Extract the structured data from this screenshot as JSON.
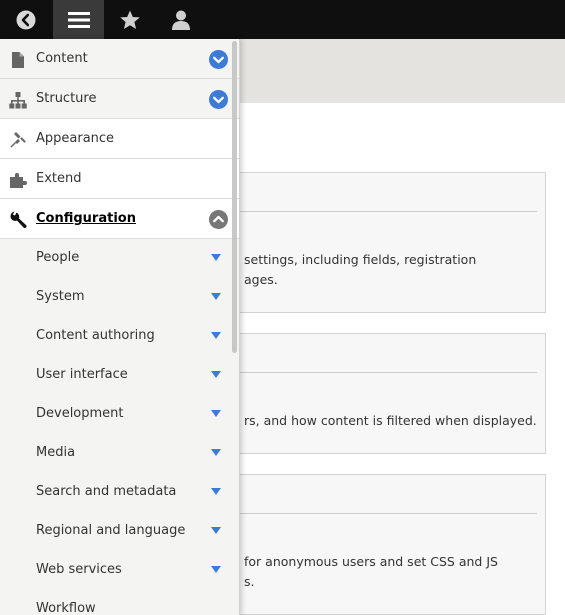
{
  "toolbar": {
    "buttons": [
      {
        "name": "back",
        "icon": "back-circle-icon"
      },
      {
        "name": "manage",
        "icon": "hamburger-menu-icon",
        "active": true
      },
      {
        "name": "shortcuts",
        "icon": "star-icon"
      },
      {
        "name": "user",
        "icon": "person-icon"
      }
    ]
  },
  "menu": {
    "items": [
      {
        "label": "Content",
        "icon": "document-icon",
        "toggle": "expand"
      },
      {
        "label": "Structure",
        "icon": "sitemap-icon",
        "toggle": "expand"
      },
      {
        "label": "Appearance",
        "icon": "paintbrush-icon"
      },
      {
        "label": "Extend",
        "icon": "puzzle-icon"
      },
      {
        "label": "Configuration",
        "icon": "wrench-icon",
        "toggle": "collapse",
        "active": true
      }
    ],
    "subitems": [
      "People",
      "System",
      "Content authoring",
      "User interface",
      "Development",
      "Media",
      "Search and metadata",
      "Regional and language",
      "Web services",
      "Workflow"
    ]
  },
  "background": {
    "panel1_line1": "settings, including fields, registration",
    "panel1_line2": "ages.",
    "panel2_line1": "rs, and how content is filtered when displayed.",
    "panel3_line1": "for anonymous users and set CSS and JS",
    "panel3_line2": "s."
  },
  "colors": {
    "toolbar": "#0f0f0f",
    "toolbar_active": "#3a3a3a",
    "toggle_blue": "#3d7bd6",
    "toggle_grey": "#777777",
    "header_band": "#e4e3df"
  }
}
